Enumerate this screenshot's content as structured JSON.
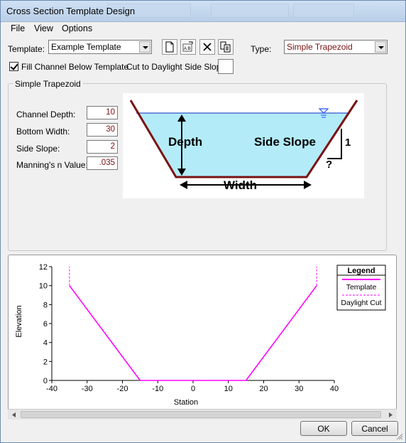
{
  "window": {
    "title": "Cross Section Template Design"
  },
  "menu": {
    "file": "File",
    "view": "View",
    "options": "Options"
  },
  "template": {
    "label": "Template:",
    "value": "Example Template"
  },
  "toolbar": {
    "new_icon": "new-document-icon",
    "rename_icon": "rename-icon",
    "delete_icon": "delete-x-icon",
    "copy_icon": "copy-icon"
  },
  "type": {
    "label": "Type:",
    "value": "Simple Trapezoid"
  },
  "fill_channel": {
    "label": "Fill Channel Below Template",
    "checked": true
  },
  "daylight": {
    "label": "Cut to Daylight Side Slope:",
    "value": ""
  },
  "group": {
    "title": "Simple Trapezoid"
  },
  "params": [
    {
      "label": "Channel Depth:",
      "value": "10"
    },
    {
      "label": "Bottom Width:",
      "value": "30"
    },
    {
      "label": "Side Slope:",
      "value": "2"
    },
    {
      "label": "Manning's n Value:",
      "value": ".035"
    }
  ],
  "illustration": {
    "depth_label": "Depth",
    "side_slope_label": "Side Slope",
    "width_label": "Width",
    "rise_label": "1",
    "run_label": "?"
  },
  "chart_data": {
    "type": "line",
    "xlabel": "Station",
    "ylabel": "Elevation",
    "xlim": [
      -40,
      40
    ],
    "ylim": [
      0,
      12
    ],
    "xticks": [
      -40,
      -30,
      -20,
      -10,
      0,
      10,
      20,
      30,
      40
    ],
    "yticks": [
      0,
      2,
      4,
      6,
      8,
      10,
      12
    ],
    "series": [
      {
        "name": "Template",
        "style": "solid",
        "color": "#ff00ff",
        "x": [
          -35,
          -15,
          15,
          35
        ],
        "y": [
          10,
          0,
          0,
          10
        ]
      },
      {
        "name": "Daylight Cut",
        "style": "dashed",
        "color": "#ff00ff",
        "segments": [
          {
            "x": [
              -35,
              -35
            ],
            "y": [
              10,
              12
            ]
          },
          {
            "x": [
              35,
              35
            ],
            "y": [
              10,
              12
            ]
          }
        ]
      }
    ],
    "legend": {
      "title": "Legend",
      "position": "top-right"
    }
  },
  "buttons": {
    "ok": "OK",
    "cancel": "Cancel"
  }
}
